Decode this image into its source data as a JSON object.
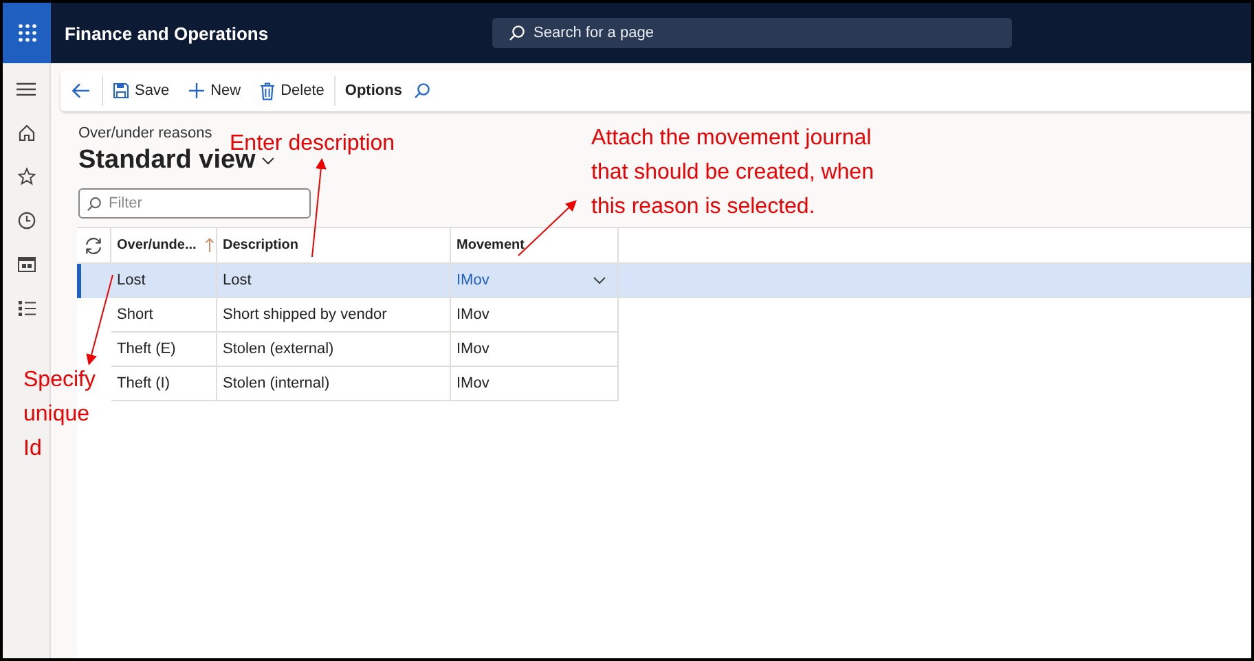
{
  "app": {
    "title": "Finance and Operations",
    "search_placeholder": "Search for a page"
  },
  "toolbar": [
    {
      "kind": "back"
    },
    {
      "kind": "save",
      "label": "Save"
    },
    {
      "kind": "new",
      "label": "New"
    },
    {
      "kind": "delete",
      "label": "Delete"
    },
    {
      "kind": "options",
      "label": "Options"
    },
    {
      "kind": "search"
    }
  ],
  "nav": [
    {
      "kind": "menu"
    },
    {
      "kind": "home"
    },
    {
      "kind": "star"
    },
    {
      "kind": "clock"
    },
    {
      "kind": "workspace"
    },
    {
      "kind": "list"
    }
  ],
  "page": {
    "breadcrumb": "Over/under reasons",
    "view_title": "Standard view",
    "filter_placeholder": "Filter"
  },
  "table": {
    "columns": [
      {
        "label": "Over/unde...",
        "sorted": true
      },
      {
        "label": "Description",
        "sorted": false
      },
      {
        "label": "Movement",
        "sorted": false
      }
    ],
    "rows": [
      {
        "cells": [
          "Lost",
          "Lost",
          "IMov"
        ],
        "selected": true
      },
      {
        "cells": [
          "Short",
          "Short shipped by vendor",
          "IMov"
        ],
        "selected": false
      },
      {
        "cells": [
          "Theft (E)",
          "Stolen (external)",
          "IMov"
        ],
        "selected": false
      },
      {
        "cells": [
          "Theft (I)",
          "Stolen (internal)",
          "IMov"
        ],
        "selected": false
      }
    ]
  },
  "annotations": [
    {
      "kind": "description",
      "lines": [
        "Enter description"
      ]
    },
    {
      "kind": "movement",
      "lines": [
        "Attach the movement journal",
        "that should be created, when",
        "this reason is selected."
      ]
    },
    {
      "kind": "id",
      "lines": [
        "Specify",
        "unique",
        "Id"
      ]
    }
  ]
}
